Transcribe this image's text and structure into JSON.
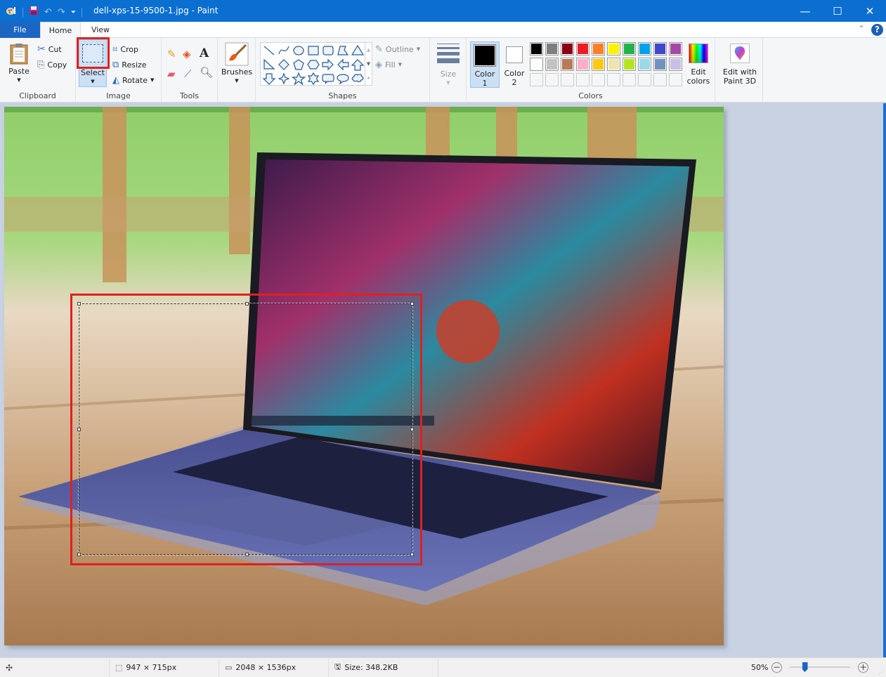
{
  "window": {
    "title": "dell-xps-15-9500-1.jpg - Paint",
    "app_icon": "paint-palette-icon",
    "quick_access": [
      "save-icon",
      "undo-icon",
      "redo-icon",
      "customize-dropdown-icon"
    ],
    "controls": {
      "minimize": "—",
      "maximize": "☐",
      "close": "✕"
    }
  },
  "tabs": [
    {
      "label": "File",
      "active": false
    },
    {
      "label": "Home",
      "active": true
    },
    {
      "label": "View",
      "active": false
    }
  ],
  "ribbon": {
    "clipboard": {
      "label": "Clipboard",
      "paste": "Paste",
      "cut": "Cut",
      "copy": "Copy"
    },
    "image": {
      "label": "Image",
      "select": "Select",
      "crop": "Crop",
      "resize": "Resize",
      "rotate": "Rotate"
    },
    "tools": {
      "label": "Tools",
      "items": [
        "pencil",
        "fill-bucket",
        "text",
        "eraser",
        "color-picker",
        "magnifier"
      ]
    },
    "brushes": {
      "label": "Brushes"
    },
    "shapes": {
      "label": "Shapes",
      "items": [
        "line",
        "curve",
        "oval",
        "rectangle",
        "rounded-rectangle",
        "polygon",
        "triangle",
        "right-triangle",
        "diamond",
        "pentagon",
        "hexagon",
        "right-arrow",
        "left-arrow",
        "up-arrow",
        "down-arrow",
        "four-point-star",
        "five-point-star",
        "six-point-star",
        "rounded-callout",
        "oval-callout",
        "cloud-callout"
      ],
      "outline": "Outline",
      "fill": "Fill"
    },
    "size": {
      "label": "Size"
    },
    "colors": {
      "label": "Colors",
      "color1_label": "Color",
      "color1_num": "1",
      "color2_label": "Color",
      "color2_num": "2",
      "color1": "#000000",
      "color2": "#ffffff",
      "palette_row1": [
        "#000000",
        "#7f7f7f",
        "#880015",
        "#ed1c24",
        "#ff7f27",
        "#fff200",
        "#22b14c",
        "#00a2e8",
        "#3f48cc",
        "#a349a4"
      ],
      "palette_row2": [
        "#ffffff",
        "#c3c3c3",
        "#b97a57",
        "#ffaec9",
        "#ffc90e",
        "#efe4b0",
        "#b5e61d",
        "#99d9ea",
        "#7092be",
        "#c8bfe7"
      ],
      "palette_row3": [
        "",
        "",
        "",
        "",
        "",
        "",
        "",
        "",
        "",
        ""
      ],
      "edit_colors_1": "Edit",
      "edit_colors_2": "colors"
    },
    "paint3d": {
      "line1": "Edit with",
      "line2": "Paint 3D"
    }
  },
  "canvas": {
    "image_description": "Dell XPS 15 laptop on wooden table with anime wallpaper",
    "highlight_color": "#e02020"
  },
  "status": {
    "selection_size": "947 × 715px",
    "image_size": "2048 × 1536px",
    "file_size": "Size: 348.2KB",
    "zoom": "50%",
    "zoom_fraction": 0.5
  }
}
